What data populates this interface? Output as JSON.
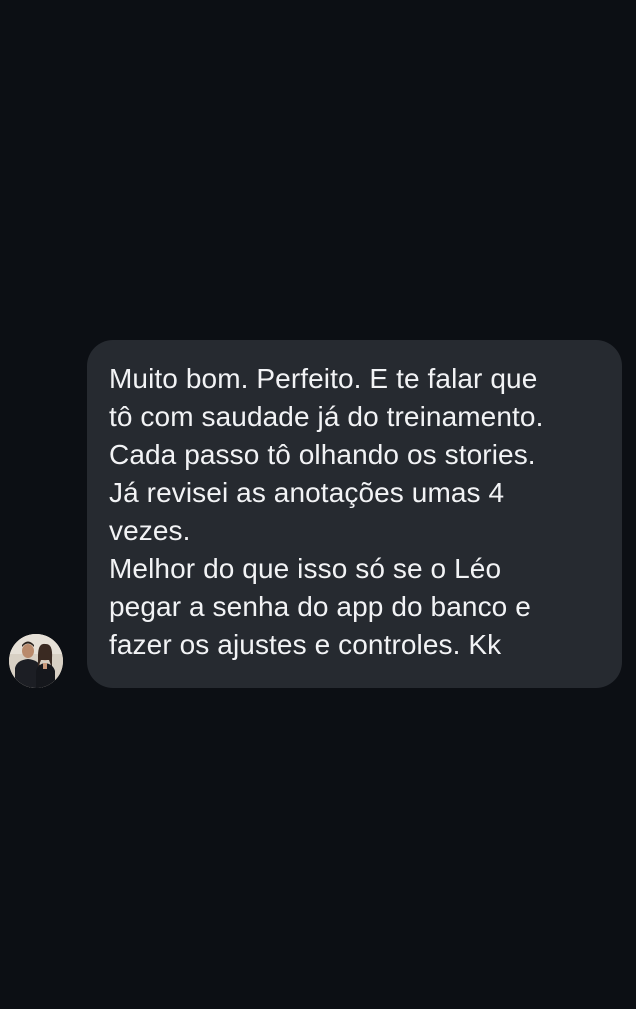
{
  "thread": {
    "message": {
      "sender_avatar": "avatar-photo",
      "paragraphs": [
        "Muito bom. Perfeito. E te falar que\ntô com saudade já do treinamento.\nCada passo tô olhando os stories.\nJá revisei as anotações umas 4\nvezes.",
        "Melhor do que isso só se o Léo\npegar a senha do app do banco e\nfazer os ajustes e controles. Kk"
      ]
    }
  },
  "colors": {
    "background": "#0c0f14",
    "bubble": "#262a30",
    "text": "#f2f3f5"
  }
}
